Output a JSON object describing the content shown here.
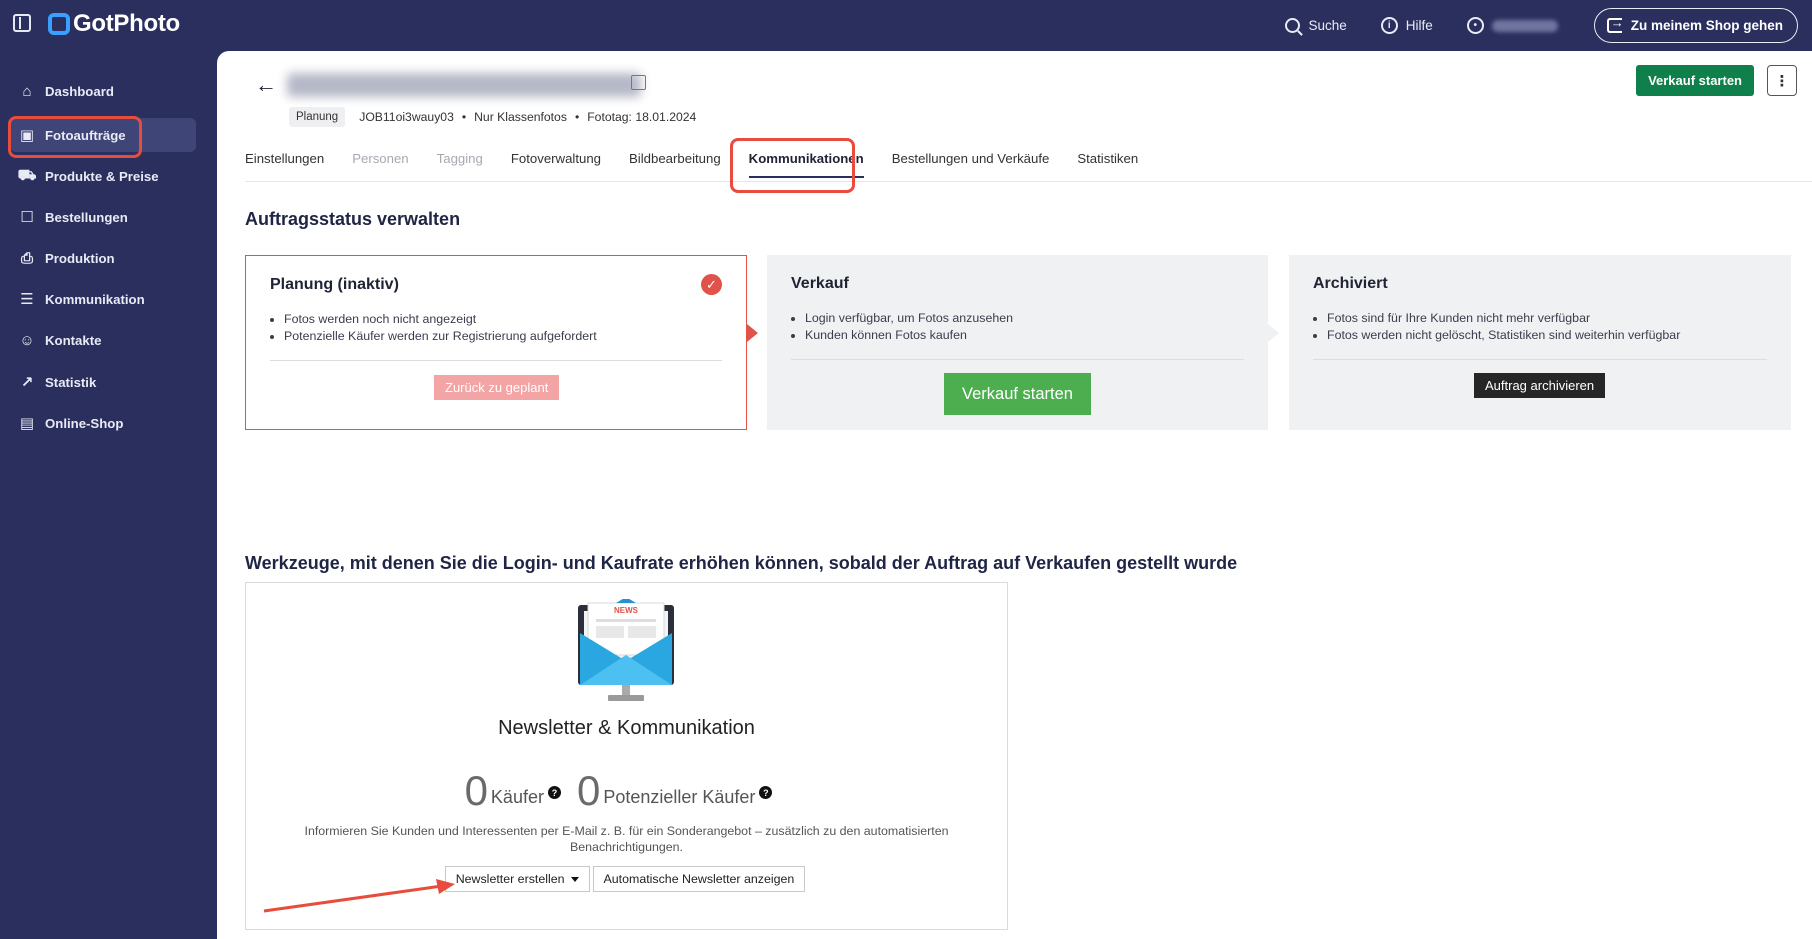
{
  "topbar": {
    "brand": "GotPhoto",
    "search_label": "Suche",
    "help_label": "Hilfe",
    "shop_button_label": "Zu meinem Shop gehen"
  },
  "sidebar": {
    "items": [
      {
        "label": "Dashboard",
        "icon": "home-icon"
      },
      {
        "label": "Fotoaufträge",
        "icon": "image-icon"
      },
      {
        "label": "Produkte & Preise",
        "icon": "cart-icon"
      },
      {
        "label": "Bestellungen",
        "icon": "box-icon"
      },
      {
        "label": "Produktion",
        "icon": "printer-icon"
      },
      {
        "label": "Kommunikation",
        "icon": "message-icon"
      },
      {
        "label": "Kontakte",
        "icon": "person-icon"
      },
      {
        "label": "Statistik",
        "icon": "chart-icon"
      },
      {
        "label": "Online-Shop",
        "icon": "store-icon"
      }
    ],
    "active_index": 1
  },
  "header": {
    "status_badge": "Planung",
    "job_id": "JOB11oi3wauy03",
    "scope": "Nur Klassenfotos",
    "photo_date": "Fototag: 18.01.2024",
    "start_sale_label": "Verkauf starten",
    "more_label": "⋮"
  },
  "tabs": [
    {
      "label": "Einstellungen",
      "state": "normal"
    },
    {
      "label": "Personen",
      "state": "disabled"
    },
    {
      "label": "Tagging",
      "state": "disabled"
    },
    {
      "label": "Fotoverwaltung",
      "state": "normal"
    },
    {
      "label": "Bildbearbeitung",
      "state": "normal"
    },
    {
      "label": "Kommunikationen",
      "state": "active"
    },
    {
      "label": "Bestellungen und Verkäufe",
      "state": "normal"
    },
    {
      "label": "Statistiken",
      "state": "normal"
    }
  ],
  "status_section": {
    "title": "Auftragsstatus verwalten",
    "planning": {
      "title": "Planung (inaktiv)",
      "bullets": [
        "Fotos werden noch nicht angezeigt",
        "Potenzielle Käufer werden zur Registrierung aufgefordert"
      ],
      "button": "Zurück zu geplant"
    },
    "sale": {
      "title": "Verkauf",
      "bullets": [
        "Login verfügbar, um Fotos anzusehen",
        "Kunden können Fotos kaufen"
      ],
      "button": "Verkauf starten"
    },
    "archived": {
      "title": "Archiviert",
      "bullets": [
        "Fotos sind für Ihre Kunden nicht mehr verfügbar",
        "Fotos werden nicht gelöscht, Statistiken sind weiterhin verfügbar"
      ],
      "button": "Auftrag archivieren"
    }
  },
  "tools_section": {
    "title": "Werkzeuge, mit denen Sie die Login- und Kaufrate erhöhen können, sobald der Auftrag auf Verkaufen gestellt wurde",
    "card_title": "Newsletter & Kommunikation",
    "illustration_badge": "NEWS",
    "buyers_count": "0",
    "buyers_label": "Käufer",
    "potential_count": "0",
    "potential_label": "Potenzieller Käufer",
    "description": "Informieren Sie Kunden und Interessenten per E-Mail z. B. für ein Sonderangebot – zusätzlich zu den automatisierten Benachrichtigungen.",
    "create_newsletter_label": "Newsletter erstellen",
    "show_auto_label": "Automatische Newsletter anzeigen"
  },
  "colors": {
    "nav_bg": "#2a2f5e",
    "primary_green": "#0f7f4b",
    "sale_green": "#4cae4f",
    "annotation_red": "#e84c3d"
  }
}
